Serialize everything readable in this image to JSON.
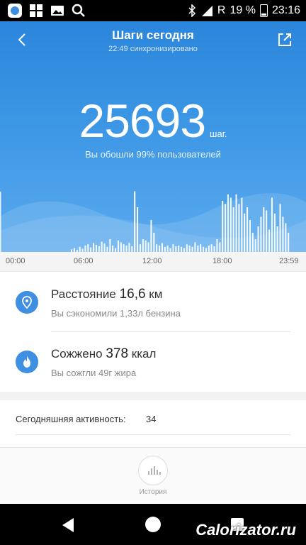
{
  "status_bar": {
    "left_icons": [
      "mi-fit-icon",
      "windows-icon",
      "gallery-icon",
      "search-icon"
    ],
    "network": "R",
    "battery_percent": "19 %",
    "time": "23:16"
  },
  "header": {
    "title": "Шаги сегодня",
    "sync_text": "22:49 синхронизировано"
  },
  "steps": {
    "value": "25693",
    "unit": "шаг.",
    "comparison": "Вы обошли 99% пользователей"
  },
  "colors": {
    "accent": "#3f8fe3",
    "hero_top": "#2b86dc",
    "hero_bottom": "#5aaaee"
  },
  "chart_data": {
    "type": "bar",
    "x_tick_labels": [
      "00:00",
      "06:00",
      "12:00",
      "18:00",
      "23:59"
    ],
    "bars_relative": [
      0.04,
      0.06,
      0.03,
      0.08,
      0.05,
      0.1,
      0.12,
      0.07,
      0.14,
      0.11,
      0.09,
      0.16,
      0.13,
      0.08,
      0.2,
      0.1,
      0.06,
      0.18,
      0.15,
      0.12,
      0.1,
      0.14,
      0.09,
      0.95,
      0.7,
      0.12,
      0.2,
      0.18,
      0.15,
      0.5,
      0.3,
      0.12,
      0.1,
      0.14,
      0.08,
      0.1,
      0.06,
      0.12,
      0.09,
      0.1,
      0.08,
      0.06,
      0.12,
      0.1,
      0.08,
      0.15,
      0.1,
      0.12,
      0.08,
      0.06,
      0.1,
      0.12,
      0.09,
      0.2,
      0.15,
      0.8,
      0.75,
      0.9,
      0.85,
      0.7,
      0.9,
      0.75,
      0.85,
      0.6,
      0.7,
      0.5,
      0.3,
      0.2,
      0.4,
      0.55,
      0.7,
      0.65,
      0.35,
      0.85,
      0.6,
      0.4,
      0.75,
      0.55,
      0.45,
      0.3
    ]
  },
  "distance": {
    "label": "Расстояние",
    "value": "16,6",
    "unit": "км",
    "sub": "Вы сэкономили 1,33л бензина"
  },
  "calories": {
    "label": "Сожжено",
    "value": "378",
    "unit": "ккал",
    "sub": "Вы сожгли 49г жира"
  },
  "activity": {
    "label": "Сегодняшняя активность:",
    "value": "34"
  },
  "bottom_nav": {
    "history_label": "История"
  },
  "watermark": "Calorizator.ru"
}
